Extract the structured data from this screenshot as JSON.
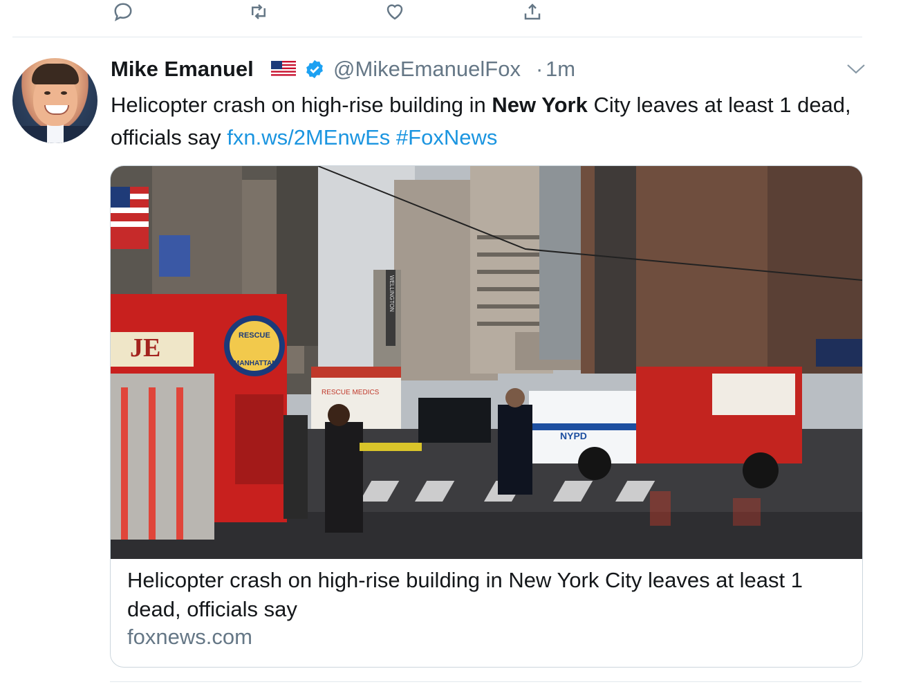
{
  "actions": {
    "reply_icon": "reply-icon",
    "retweet_icon": "retweet-icon",
    "like_icon": "heart-icon",
    "share_icon": "share-icon"
  },
  "tweet": {
    "author_name": "Mike Emanuel",
    "flag_emoji": "flag-us-icon",
    "handle": "@MikeEmanuelFox",
    "separator": "·",
    "time": "1m",
    "text_part1": "Helicopter crash on high-rise building in ",
    "text_bold": "New York",
    "text_part2": " City leaves at least 1 dead, officials say ",
    "link_url": "fxn.ws/2MEnwEs",
    "hashtag": "#FoxNews"
  },
  "card": {
    "title": "Helicopter crash on high-rise building in New York City leaves at least 1 dead, officials say",
    "domain": "foxnews.com",
    "image_labels": {
      "rescue": "RESCUE",
      "manhattan": "MANHATTAN",
      "nypd": "NYPD",
      "rescue_medics": "RESCUE MEDICS",
      "wellington": "WELLINGTON"
    }
  },
  "colors": {
    "link": "#1b95e0",
    "secondary": "#657786",
    "verified": "#1da1f2",
    "border": "#ccd6dd"
  }
}
